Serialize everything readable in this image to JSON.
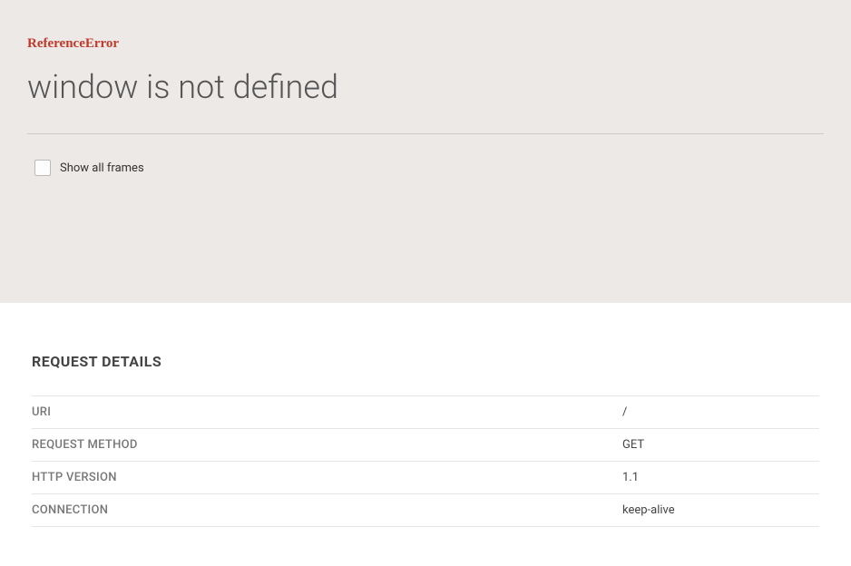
{
  "error": {
    "type": "ReferenceError",
    "message": "window is not defined"
  },
  "controls": {
    "show_all_frames_label": "Show all frames"
  },
  "details": {
    "heading": "REQUEST DETAILS",
    "rows": [
      {
        "key": "URI",
        "value": "/"
      },
      {
        "key": "REQUEST METHOD",
        "value": "GET"
      },
      {
        "key": "HTTP VERSION",
        "value": "1.1"
      },
      {
        "key": "CONNECTION",
        "value": "keep-alive"
      }
    ]
  }
}
